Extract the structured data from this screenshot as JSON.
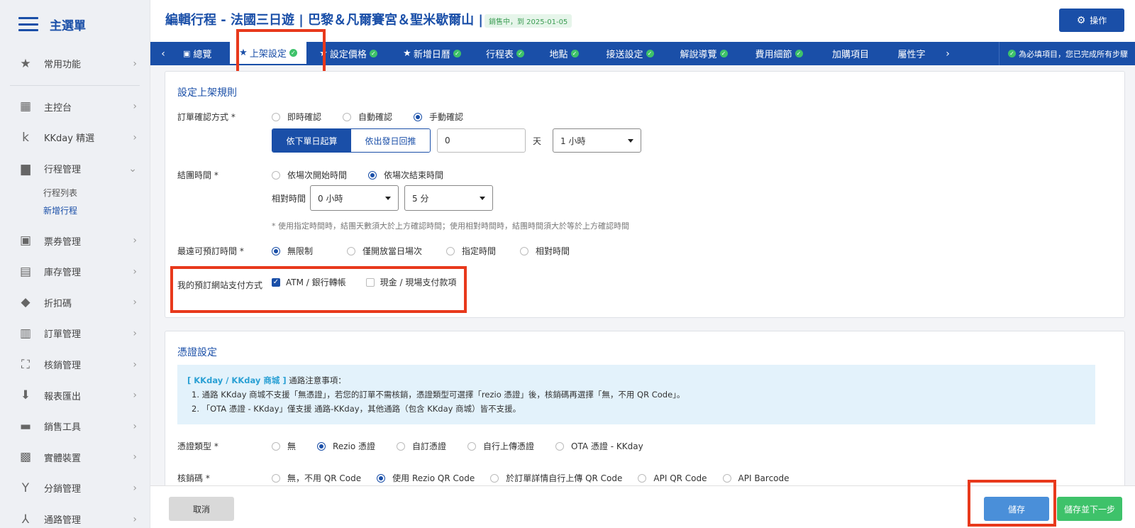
{
  "sidebar": {
    "title": "主選單",
    "items": [
      {
        "label": "常用功能",
        "icon": "star-icon",
        "glyph": "★"
      },
      {
        "label": "主控台",
        "icon": "dashboard-icon",
        "glyph": "▦"
      },
      {
        "label": "KKday 精選",
        "icon": "kkday-icon",
        "glyph": "k"
      },
      {
        "label": "行程管理",
        "icon": "folder-star-icon",
        "glyph": "▆"
      },
      {
        "label": "票券管理",
        "icon": "ticket-icon",
        "glyph": "▣"
      },
      {
        "label": "庫存管理",
        "icon": "calendar-icon",
        "glyph": "▤"
      },
      {
        "label": "折扣碼",
        "icon": "tag-icon",
        "glyph": "◆"
      },
      {
        "label": "訂單管理",
        "icon": "document-icon",
        "glyph": "▥"
      },
      {
        "label": "核銷管理",
        "icon": "scan-icon",
        "glyph": "⛶"
      },
      {
        "label": "報表匯出",
        "icon": "download-icon",
        "glyph": "⬇"
      },
      {
        "label": "銷售工具",
        "icon": "store-icon",
        "glyph": "▬"
      },
      {
        "label": "實體裝置",
        "icon": "register-icon",
        "glyph": "▩"
      },
      {
        "label": "分銷管理",
        "icon": "split-icon",
        "glyph": "Y"
      },
      {
        "label": "通路管理",
        "icon": "network-icon",
        "glyph": "⅄"
      }
    ],
    "sub_items": [
      "行程列表",
      "新增行程"
    ]
  },
  "header": {
    "title": "編輯行程 - 法國三日遊 | 巴黎＆凡爾賽宮＆聖米歇爾山 |",
    "badge": "銷售中，到 2025-01-05",
    "action_label": "操作"
  },
  "tabs": [
    {
      "label": "總覽",
      "check": false,
      "icon": "image-icon"
    },
    {
      "label": "上架設定",
      "check": true,
      "active": true
    },
    {
      "label": "設定價格",
      "check": true
    },
    {
      "label": "新增日曆",
      "check": true
    },
    {
      "label": "行程表",
      "check": true
    },
    {
      "label": "地點",
      "check": true
    },
    {
      "label": "接送設定",
      "check": true
    },
    {
      "label": "解說導覽",
      "check": true
    },
    {
      "label": "費用細節",
      "check": true
    },
    {
      "label": "加購項目",
      "check": false
    },
    {
      "label": "屬性字",
      "check": false
    }
  ],
  "tab_notice": "為必填項目，您已完成所有步驟",
  "listing": {
    "title": "設定上架規則",
    "confirm_label": "訂單確認方式 *",
    "confirm_options": [
      "即時確認",
      "自動確認",
      "手動確認"
    ],
    "seg_options": [
      "依下單日起算",
      "依出發日回推"
    ],
    "days_value": "0",
    "days_unit": "天",
    "hours_value": "1 小時",
    "close_label": "結團時間 *",
    "close_options": [
      "依場次開始時間",
      "依場次結束時間"
    ],
    "relative_label": "相對時間",
    "relative_hours": "0 小時",
    "relative_minutes": "5 分",
    "close_hint": "* 使用指定時間時，結團天數須大於上方確認時間；使用相對時間時，結團時間須大於等於上方確認時間",
    "latest_label": "最遠可預訂時間 *",
    "latest_options": [
      "無限制",
      "僅開放當日場次",
      "指定時間",
      "相對時間"
    ],
    "payment_label": "我的預訂網站支付方式",
    "payment_options": [
      "ATM / 銀行轉帳",
      "現金 / 現場支付款項"
    ]
  },
  "voucher": {
    "title": "憑證設定",
    "notice_prefix": "[ KKday / KKday 商城 ]",
    "notice_head": " 通路注意事項：",
    "notice_lines": [
      "1. 通路 KKday 商城不支援「無憑證」，若您的訂單不需核銷，憑證類型可選擇「rezio 憑證」後，核銷碼再選擇「無，不用 QR Code」。",
      "2. 「OTA 憑證 - KKday」僅支援 通路-KKday，其他通路（包含 KKday 商城）皆不支援。"
    ],
    "type_label": "憑證類型 *",
    "type_options": [
      "無",
      "Rezio 憑證",
      "自訂憑證",
      "自行上傳憑證",
      "OTA 憑證 - KKday"
    ],
    "code_label": "核銷碼 *",
    "code_options": [
      "無，不用 QR Code",
      "使用 Rezio QR Code",
      "於訂單詳情自行上傳 QR Code",
      "API QR Code",
      "API Barcode"
    ]
  },
  "footer": {
    "cancel": "取消",
    "save": "儲存",
    "save_next": "儲存並下一步"
  },
  "colors": {
    "primary": "#1a4fa8",
    "success": "#3ec26a",
    "highlight": "#e8391c"
  }
}
